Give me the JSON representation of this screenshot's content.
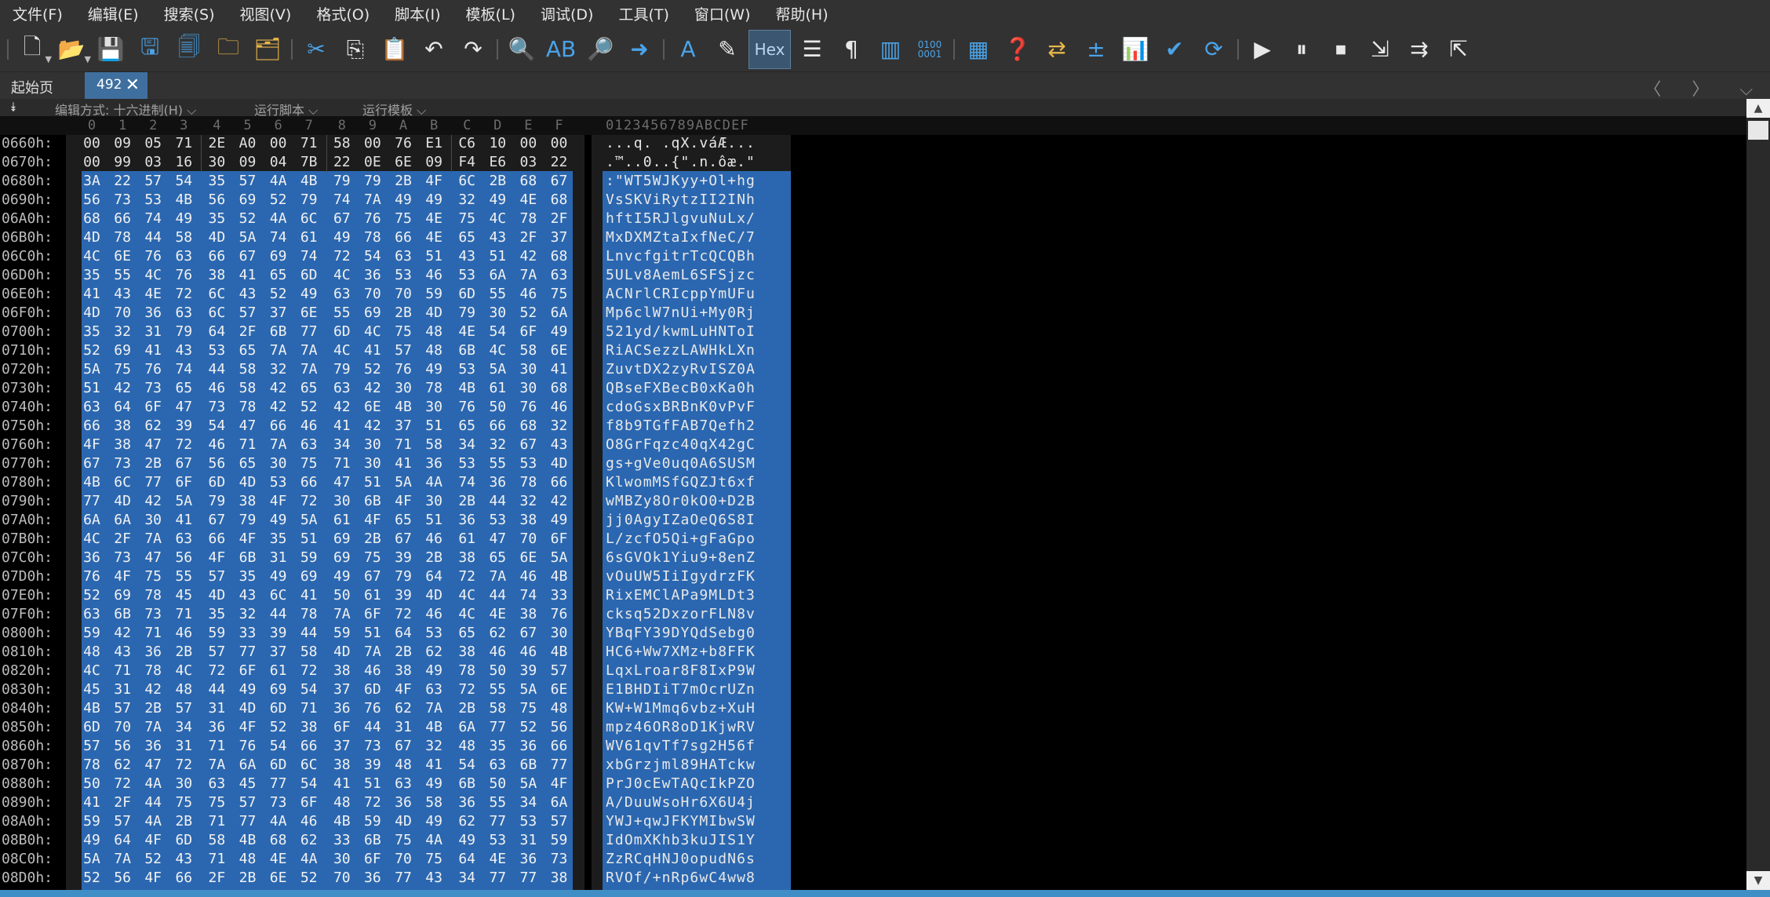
{
  "menu": [
    "文件(F)",
    "编辑(E)",
    "搜索(S)",
    "视图(V)",
    "格式(O)",
    "脚本(I)",
    "模板(L)",
    "调试(D)",
    "工具(T)",
    "窗口(W)",
    "帮助(H)"
  ],
  "toolbar": {
    "hex_label": "Hex",
    "text_label_a": "A",
    "text_label_ab": "AB",
    "binary_label": "0100\n0001",
    "pilcrow": "¶"
  },
  "tabs": {
    "start_label": "起始页",
    "file_label": "492",
    "close_glyph": "✕",
    "nav": "〈 〉 ⌵"
  },
  "options": {
    "collapse": "⯯",
    "edit_mode": "编辑方式: 十六进制(H) ⌵",
    "run_script": "运行脚本 ⌵",
    "run_template": "运行模板 ⌵"
  },
  "columns": [
    "0",
    "1",
    "2",
    "3",
    "4",
    "5",
    "6",
    "7",
    "8",
    "9",
    "A",
    "B",
    "C",
    "D",
    "E",
    "F"
  ],
  "ascii_header": "0123456789ABCDEF",
  "rows": [
    {
      "addr": "0660h:",
      "bytes": [
        "00",
        "09",
        "05",
        "71",
        "2E",
        "A0",
        "00",
        "71",
        "58",
        "00",
        "76",
        "E1",
        "C6",
        "10",
        "00",
        "00"
      ],
      "ascii": "...q. .qX.váÆ..."
    },
    {
      "addr": "0670h:",
      "bytes": [
        "00",
        "99",
        "03",
        "16",
        "30",
        "09",
        "04",
        "7B",
        "22",
        "0E",
        "6E",
        "09",
        "F4",
        "E6",
        "03",
        "22"
      ],
      "ascii": ".™..0..{\".n.ôæ.\""
    },
    {
      "addr": "0680h:",
      "bytes": [
        "3A",
        "22",
        "57",
        "54",
        "35",
        "57",
        "4A",
        "4B",
        "79",
        "79",
        "2B",
        "4F",
        "6C",
        "2B",
        "68",
        "67"
      ],
      "ascii": ":\"WT5WJKyy+Ol+hg"
    },
    {
      "addr": "0690h:",
      "bytes": [
        "56",
        "73",
        "53",
        "4B",
        "56",
        "69",
        "52",
        "79",
        "74",
        "7A",
        "49",
        "49",
        "32",
        "49",
        "4E",
        "68"
      ],
      "ascii": "VsSKViRytzII2INh"
    },
    {
      "addr": "06A0h:",
      "bytes": [
        "68",
        "66",
        "74",
        "49",
        "35",
        "52",
        "4A",
        "6C",
        "67",
        "76",
        "75",
        "4E",
        "75",
        "4C",
        "78",
        "2F"
      ],
      "ascii": "hftI5RJlgvuNuLx/"
    },
    {
      "addr": "06B0h:",
      "bytes": [
        "4D",
        "78",
        "44",
        "58",
        "4D",
        "5A",
        "74",
        "61",
        "49",
        "78",
        "66",
        "4E",
        "65",
        "43",
        "2F",
        "37"
      ],
      "ascii": "MxDXMZtaIxfNeC/7"
    },
    {
      "addr": "06C0h:",
      "bytes": [
        "4C",
        "6E",
        "76",
        "63",
        "66",
        "67",
        "69",
        "74",
        "72",
        "54",
        "63",
        "51",
        "43",
        "51",
        "42",
        "68"
      ],
      "ascii": "LnvcfgitrTcQCQBh"
    },
    {
      "addr": "06D0h:",
      "bytes": [
        "35",
        "55",
        "4C",
        "76",
        "38",
        "41",
        "65",
        "6D",
        "4C",
        "36",
        "53",
        "46",
        "53",
        "6A",
        "7A",
        "63"
      ],
      "ascii": "5ULv8AemL6SFSjzc"
    },
    {
      "addr": "06E0h:",
      "bytes": [
        "41",
        "43",
        "4E",
        "72",
        "6C",
        "43",
        "52",
        "49",
        "63",
        "70",
        "70",
        "59",
        "6D",
        "55",
        "46",
        "75"
      ],
      "ascii": "ACNrlCRIcppYmUFu"
    },
    {
      "addr": "06F0h:",
      "bytes": [
        "4D",
        "70",
        "36",
        "63",
        "6C",
        "57",
        "37",
        "6E",
        "55",
        "69",
        "2B",
        "4D",
        "79",
        "30",
        "52",
        "6A"
      ],
      "ascii": "Mp6clW7nUi+My0Rj"
    },
    {
      "addr": "0700h:",
      "bytes": [
        "35",
        "32",
        "31",
        "79",
        "64",
        "2F",
        "6B",
        "77",
        "6D",
        "4C",
        "75",
        "48",
        "4E",
        "54",
        "6F",
        "49"
      ],
      "ascii": "521yd/kwmLuHNToI"
    },
    {
      "addr": "0710h:",
      "bytes": [
        "52",
        "69",
        "41",
        "43",
        "53",
        "65",
        "7A",
        "7A",
        "4C",
        "41",
        "57",
        "48",
        "6B",
        "4C",
        "58",
        "6E"
      ],
      "ascii": "RiACSezzLAWHkLXn"
    },
    {
      "addr": "0720h:",
      "bytes": [
        "5A",
        "75",
        "76",
        "74",
        "44",
        "58",
        "32",
        "7A",
        "79",
        "52",
        "76",
        "49",
        "53",
        "5A",
        "30",
        "41"
      ],
      "ascii": "ZuvtDX2zyRvISZ0A"
    },
    {
      "addr": "0730h:",
      "bytes": [
        "51",
        "42",
        "73",
        "65",
        "46",
        "58",
        "42",
        "65",
        "63",
        "42",
        "30",
        "78",
        "4B",
        "61",
        "30",
        "68"
      ],
      "ascii": "QBseFXBecB0xKa0h"
    },
    {
      "addr": "0740h:",
      "bytes": [
        "63",
        "64",
        "6F",
        "47",
        "73",
        "78",
        "42",
        "52",
        "42",
        "6E",
        "4B",
        "30",
        "76",
        "50",
        "76",
        "46"
      ],
      "ascii": "cdoGsxBRBnK0vPvF"
    },
    {
      "addr": "0750h:",
      "bytes": [
        "66",
        "38",
        "62",
        "39",
        "54",
        "47",
        "66",
        "46",
        "41",
        "42",
        "37",
        "51",
        "65",
        "66",
        "68",
        "32"
      ],
      "ascii": "f8b9TGfFAB7Qefh2"
    },
    {
      "addr": "0760h:",
      "bytes": [
        "4F",
        "38",
        "47",
        "72",
        "46",
        "71",
        "7A",
        "63",
        "34",
        "30",
        "71",
        "58",
        "34",
        "32",
        "67",
        "43"
      ],
      "ascii": "O8GrFqzc40qX42gC"
    },
    {
      "addr": "0770h:",
      "bytes": [
        "67",
        "73",
        "2B",
        "67",
        "56",
        "65",
        "30",
        "75",
        "71",
        "30",
        "41",
        "36",
        "53",
        "55",
        "53",
        "4D"
      ],
      "ascii": "gs+gVe0uq0A6SUSM"
    },
    {
      "addr": "0780h:",
      "bytes": [
        "4B",
        "6C",
        "77",
        "6F",
        "6D",
        "4D",
        "53",
        "66",
        "47",
        "51",
        "5A",
        "4A",
        "74",
        "36",
        "78",
        "66"
      ],
      "ascii": "KlwomMSfGQZJt6xf"
    },
    {
      "addr": "0790h:",
      "bytes": [
        "77",
        "4D",
        "42",
        "5A",
        "79",
        "38",
        "4F",
        "72",
        "30",
        "6B",
        "4F",
        "30",
        "2B",
        "44",
        "32",
        "42"
      ],
      "ascii": "wMBZy8Or0kO0+D2B"
    },
    {
      "addr": "07A0h:",
      "bytes": [
        "6A",
        "6A",
        "30",
        "41",
        "67",
        "79",
        "49",
        "5A",
        "61",
        "4F",
        "65",
        "51",
        "36",
        "53",
        "38",
        "49"
      ],
      "ascii": "jj0AgyIZaOeQ6S8I"
    },
    {
      "addr": "07B0h:",
      "bytes": [
        "4C",
        "2F",
        "7A",
        "63",
        "66",
        "4F",
        "35",
        "51",
        "69",
        "2B",
        "67",
        "46",
        "61",
        "47",
        "70",
        "6F"
      ],
      "ascii": "L/zcfO5Qi+gFaGpo"
    },
    {
      "addr": "07C0h:",
      "bytes": [
        "36",
        "73",
        "47",
        "56",
        "4F",
        "6B",
        "31",
        "59",
        "69",
        "75",
        "39",
        "2B",
        "38",
        "65",
        "6E",
        "5A"
      ],
      "ascii": "6sGVOk1Yiu9+8enZ"
    },
    {
      "addr": "07D0h:",
      "bytes": [
        "76",
        "4F",
        "75",
        "55",
        "57",
        "35",
        "49",
        "69",
        "49",
        "67",
        "79",
        "64",
        "72",
        "7A",
        "46",
        "4B"
      ],
      "ascii": "vOuUW5IiIgydrzFK"
    },
    {
      "addr": "07E0h:",
      "bytes": [
        "52",
        "69",
        "78",
        "45",
        "4D",
        "43",
        "6C",
        "41",
        "50",
        "61",
        "39",
        "4D",
        "4C",
        "44",
        "74",
        "33"
      ],
      "ascii": "RixEMClAPa9MLDt3"
    },
    {
      "addr": "07F0h:",
      "bytes": [
        "63",
        "6B",
        "73",
        "71",
        "35",
        "32",
        "44",
        "78",
        "7A",
        "6F",
        "72",
        "46",
        "4C",
        "4E",
        "38",
        "76"
      ],
      "ascii": "cksq52DxzorFLN8v"
    },
    {
      "addr": "0800h:",
      "bytes": [
        "59",
        "42",
        "71",
        "46",
        "59",
        "33",
        "39",
        "44",
        "59",
        "51",
        "64",
        "53",
        "65",
        "62",
        "67",
        "30"
      ],
      "ascii": "YBqFY39DYQdSebg0"
    },
    {
      "addr": "0810h:",
      "bytes": [
        "48",
        "43",
        "36",
        "2B",
        "57",
        "77",
        "37",
        "58",
        "4D",
        "7A",
        "2B",
        "62",
        "38",
        "46",
        "46",
        "4B"
      ],
      "ascii": "HC6+Ww7XMz+b8FFK"
    },
    {
      "addr": "0820h:",
      "bytes": [
        "4C",
        "71",
        "78",
        "4C",
        "72",
        "6F",
        "61",
        "72",
        "38",
        "46",
        "38",
        "49",
        "78",
        "50",
        "39",
        "57"
      ],
      "ascii": "LqxLroar8F8IxP9W"
    },
    {
      "addr": "0830h:",
      "bytes": [
        "45",
        "31",
        "42",
        "48",
        "44",
        "49",
        "69",
        "54",
        "37",
        "6D",
        "4F",
        "63",
        "72",
        "55",
        "5A",
        "6E"
      ],
      "ascii": "E1BHDIiT7mOcrUZn"
    },
    {
      "addr": "0840h:",
      "bytes": [
        "4B",
        "57",
        "2B",
        "57",
        "31",
        "4D",
        "6D",
        "71",
        "36",
        "76",
        "62",
        "7A",
        "2B",
        "58",
        "75",
        "48"
      ],
      "ascii": "KW+W1Mmq6vbz+XuH"
    },
    {
      "addr": "0850h:",
      "bytes": [
        "6D",
        "70",
        "7A",
        "34",
        "36",
        "4F",
        "52",
        "38",
        "6F",
        "44",
        "31",
        "4B",
        "6A",
        "77",
        "52",
        "56"
      ],
      "ascii": "mpz46OR8oD1KjwRV"
    },
    {
      "addr": "0860h:",
      "bytes": [
        "57",
        "56",
        "36",
        "31",
        "71",
        "76",
        "54",
        "66",
        "37",
        "73",
        "67",
        "32",
        "48",
        "35",
        "36",
        "66"
      ],
      "ascii": "WV61qvTf7sg2H56f"
    },
    {
      "addr": "0870h:",
      "bytes": [
        "78",
        "62",
        "47",
        "72",
        "7A",
        "6A",
        "6D",
        "6C",
        "38",
        "39",
        "48",
        "41",
        "54",
        "63",
        "6B",
        "77"
      ],
      "ascii": "xbGrzjml89HATckw"
    },
    {
      "addr": "0880h:",
      "bytes": [
        "50",
        "72",
        "4A",
        "30",
        "63",
        "45",
        "77",
        "54",
        "41",
        "51",
        "63",
        "49",
        "6B",
        "50",
        "5A",
        "4F"
      ],
      "ascii": "PrJ0cEwTAQcIkPZO"
    },
    {
      "addr": "0890h:",
      "bytes": [
        "41",
        "2F",
        "44",
        "75",
        "75",
        "57",
        "73",
        "6F",
        "48",
        "72",
        "36",
        "58",
        "36",
        "55",
        "34",
        "6A"
      ],
      "ascii": "A/DuuWsoHr6X6U4j"
    },
    {
      "addr": "08A0h:",
      "bytes": [
        "59",
        "57",
        "4A",
        "2B",
        "71",
        "77",
        "4A",
        "46",
        "4B",
        "59",
        "4D",
        "49",
        "62",
        "77",
        "53",
        "57"
      ],
      "ascii": "YWJ+qwJFKYMIbwSW"
    },
    {
      "addr": "08B0h:",
      "bytes": [
        "49",
        "64",
        "4F",
        "6D",
        "58",
        "4B",
        "68",
        "62",
        "33",
        "6B",
        "75",
        "4A",
        "49",
        "53",
        "31",
        "59"
      ],
      "ascii": "IdOmXKhb3kuJIS1Y"
    },
    {
      "addr": "08C0h:",
      "bytes": [
        "5A",
        "7A",
        "52",
        "43",
        "71",
        "48",
        "4E",
        "4A",
        "30",
        "6F",
        "70",
        "75",
        "64",
        "4E",
        "36",
        "73"
      ],
      "ascii": "ZzRCqHNJ0opudN6s"
    },
    {
      "addr": "08D0h:",
      "bytes": [
        "52",
        "56",
        "4F",
        "66",
        "2F",
        "2B",
        "6E",
        "52",
        "70",
        "36",
        "77",
        "43",
        "34",
        "77",
        "77",
        "38"
      ],
      "ascii": "RVOf/+nRp6wC4ww8"
    }
  ],
  "colors": {
    "selection": "#2b67b0",
    "background": "#000000",
    "chrome": "#323232",
    "active_tab": "#3f6f9e"
  }
}
